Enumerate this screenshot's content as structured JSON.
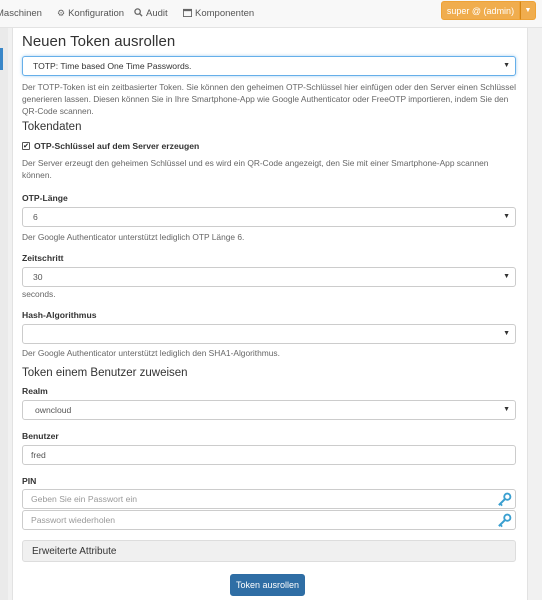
{
  "nav": {
    "items": [
      {
        "label": "Maschinen",
        "icon": ""
      },
      {
        "label": "Konfiguration",
        "icon": "gear-icon"
      },
      {
        "label": "Audit",
        "icon": "search-icon"
      },
      {
        "label": "Komponenten",
        "icon": "calendar-icon"
      }
    ],
    "user_label": "super @ (admin)"
  },
  "form": {
    "title": "Neuen Token ausrollen",
    "token_type": {
      "selected": "TOTP: Time based One Time Passwords.",
      "description": "Der TOTP-Token ist ein zeitbasierter Token. Sie können den geheimen OTP-Schlüssel hier einfügen oder den Server einen Schlüssel generieren lassen. Diesen können Sie in Ihre Smartphone-App wie Google Authenticator oder FreeOTP importieren, indem Sie den QR-Code scannen."
    },
    "tokendata": {
      "heading": "Tokendaten",
      "generate_checkbox_label": "OTP-Schlüssel auf dem Server erzeugen",
      "generate_checked": true,
      "generate_help": "Der Server erzeugt den geheimen Schlüssel und es wird ein QR-Code angezeigt, den Sie mit einer Smartphone-App scannen können.",
      "otp_length": {
        "label": "OTP-Länge",
        "value": "6",
        "help": "Der Google Authenticator unterstützt lediglich OTP Länge 6."
      },
      "timestep": {
        "label": "Zeitschritt",
        "value": "30",
        "help": "seconds."
      },
      "hash": {
        "label": "Hash-Algorithmus",
        "value": "",
        "help": "Der Google Authenticator unterstützt lediglich den SHA1-Algorithmus."
      }
    },
    "assign": {
      "heading": "Token einem Benutzer zuweisen",
      "realm": {
        "label": "Realm",
        "value": "owncloud"
      },
      "user": {
        "label": "Benutzer",
        "value": "fred"
      },
      "pin": {
        "label": "PIN",
        "placeholder": "Geben Sie ein Passwort ein",
        "repeat_placeholder": "Passwort wiederholen"
      }
    },
    "advanced_label": "Erweiterte Attribute",
    "submit_label": "Token ausrollen"
  },
  "colors": {
    "primary": "#2f6ea5",
    "warning": "#f0ad4e",
    "key_icon": "#3a9fd0"
  }
}
